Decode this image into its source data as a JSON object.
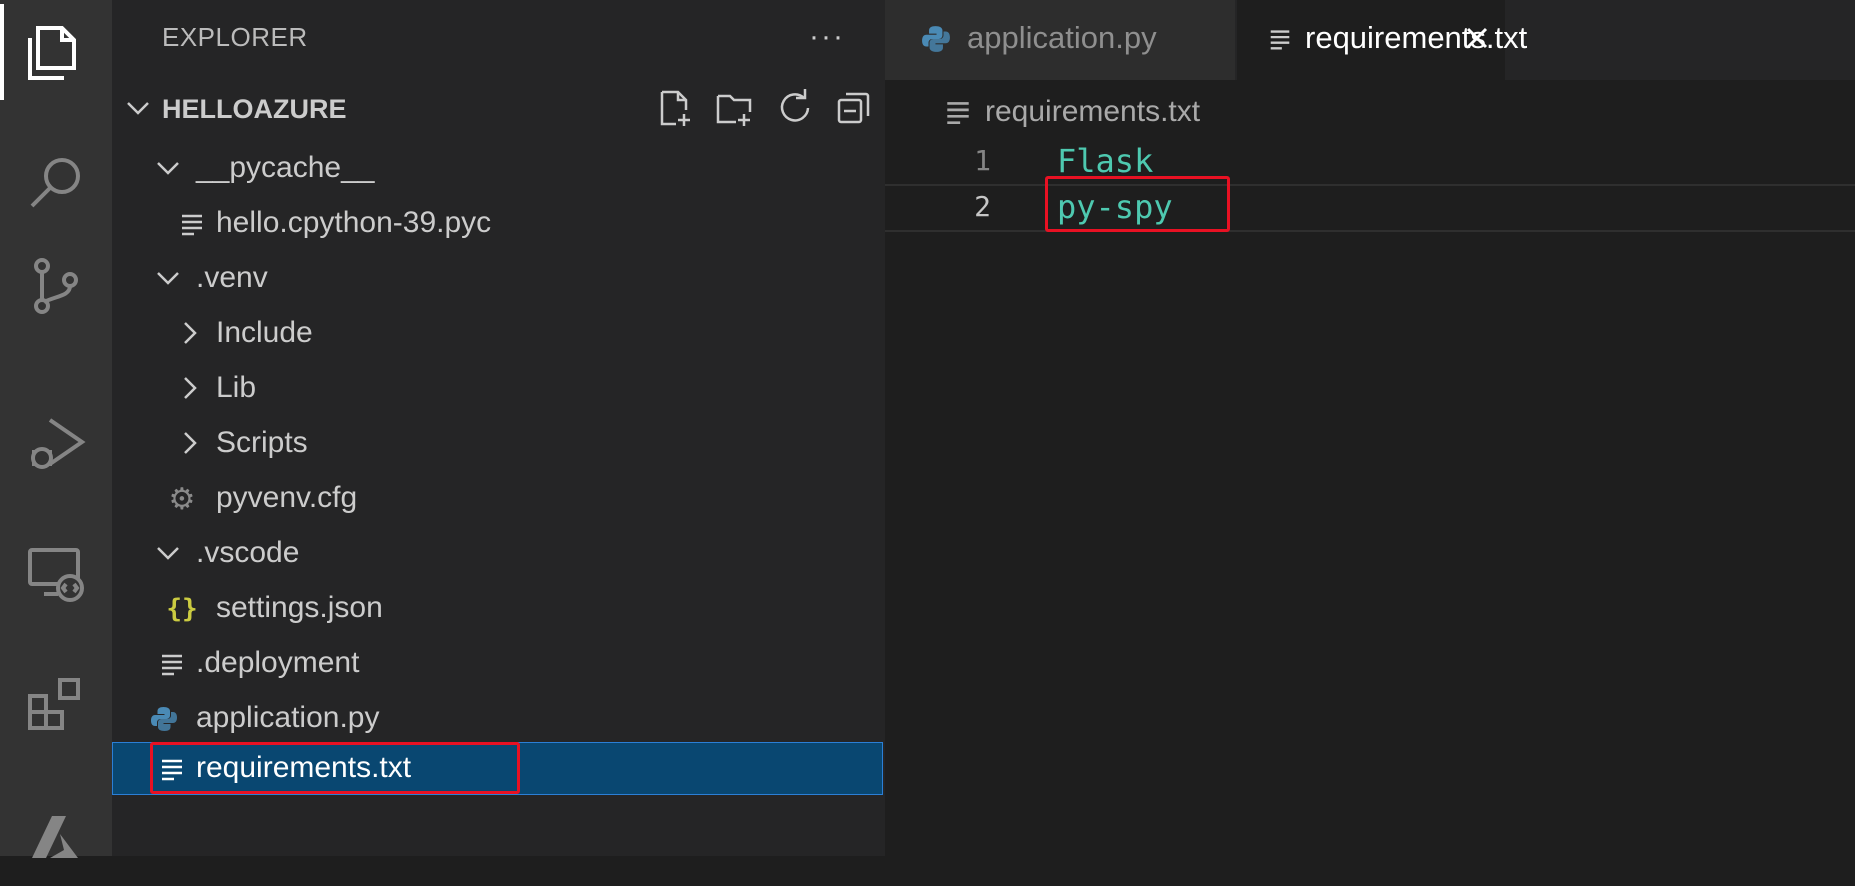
{
  "activity_bar": {
    "items": [
      {
        "name": "explorer-icon",
        "active": true
      },
      {
        "name": "search-icon",
        "active": false
      },
      {
        "name": "source-control-icon",
        "active": false
      },
      {
        "name": "run-debug-icon",
        "active": false
      },
      {
        "name": "remote-explorer-icon",
        "active": false
      },
      {
        "name": "extensions-icon",
        "active": false
      },
      {
        "name": "azure-icon",
        "active": false
      }
    ]
  },
  "sidebar": {
    "title": "EXPLORER",
    "more_actions": "···",
    "folder": {
      "name": "HELLOAZURE",
      "actions": [
        "new-file-icon",
        "new-folder-icon",
        "refresh-icon",
        "collapse-all-icon"
      ]
    },
    "tree": [
      {
        "label": "__pycache__",
        "type": "folder",
        "expanded": true
      },
      {
        "label": "hello.cpython-39.pyc",
        "type": "text-file"
      },
      {
        "label": ".venv",
        "type": "folder",
        "expanded": true
      },
      {
        "label": "Include",
        "type": "folder",
        "expanded": false
      },
      {
        "label": "Lib",
        "type": "folder",
        "expanded": false
      },
      {
        "label": "Scripts",
        "type": "folder",
        "expanded": false
      },
      {
        "label": "pyvenv.cfg",
        "type": "gear-file"
      },
      {
        "label": ".vscode",
        "type": "folder",
        "expanded": true
      },
      {
        "label": "settings.json",
        "type": "json-file"
      },
      {
        "label": ".deployment",
        "type": "text-file"
      },
      {
        "label": "application.py",
        "type": "python-file"
      },
      {
        "label": "requirements.txt",
        "type": "text-file",
        "selected": true
      }
    ]
  },
  "editor": {
    "tabs": [
      {
        "label": "application.py",
        "icon": "python-icon",
        "active": false
      },
      {
        "label": "requirements.txt",
        "icon": "text-file-icon",
        "active": true,
        "close_icon": "close-icon"
      }
    ],
    "breadcrumb": "requirements.txt",
    "lines": [
      {
        "number": "1",
        "text": "Flask"
      },
      {
        "number": "2",
        "text": "py-spy"
      }
    ]
  },
  "colors": {
    "activity_bar": "#333333",
    "sidebar": "#252526",
    "editor": "#1e1e1e",
    "selection": "#094771",
    "highlight_box": "#e81123",
    "code_text": "#4ec9b0"
  }
}
